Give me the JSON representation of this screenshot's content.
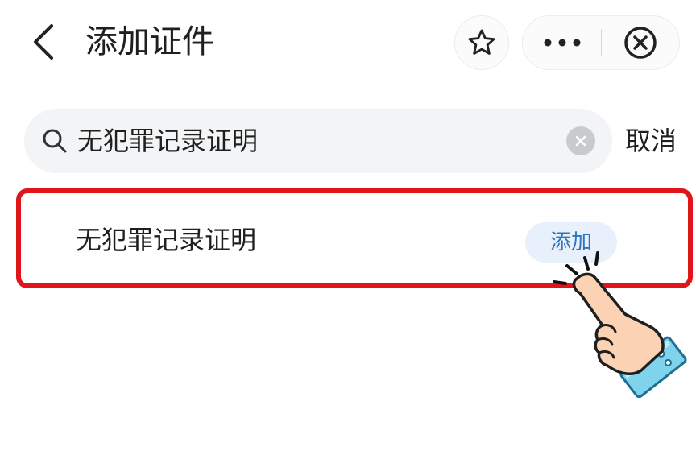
{
  "header": {
    "back_icon": "chevron-left-icon",
    "title": "添加证件",
    "favorite_icon": "star-outline-icon",
    "more_icon": "more-dots-icon",
    "close_icon": "circle-close-icon"
  },
  "search": {
    "icon": "search-icon",
    "value": "无犯罪记录证明",
    "clear_icon": "clear-x-icon",
    "cancel_label": "取消"
  },
  "results": [
    {
      "label": "无犯罪记录证明",
      "action_label": "添加"
    }
  ],
  "overlay": {
    "pointer_icon": "pointing-hand-icon"
  },
  "colors": {
    "highlight_border": "#e2141b",
    "add_button_bg": "#e8f1fb",
    "add_button_text": "#2f74c0",
    "search_bg": "#f3f4f6"
  }
}
